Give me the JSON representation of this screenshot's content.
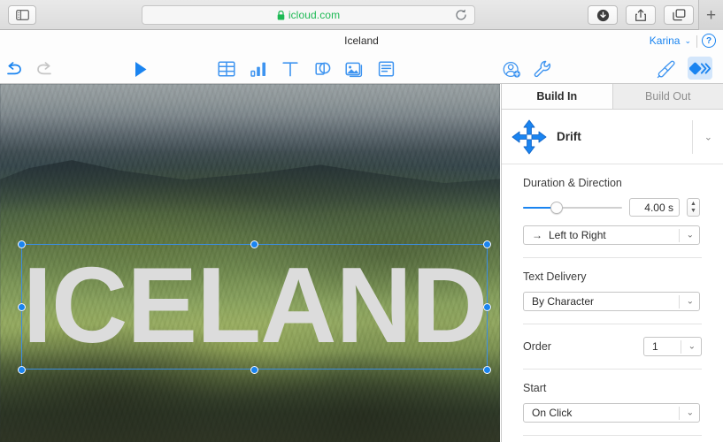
{
  "browser": {
    "sidebar_icon": "sidebar-toggle-icon",
    "url": "icloud.com",
    "lock_icon": "lock-icon",
    "reload_icon": "reload-icon",
    "downloads_icon": "downloads-icon",
    "share_icon": "share-icon",
    "tab_overview_icon": "tab-overview-icon",
    "new_tab_label": "+",
    "accent_green": "#1db954"
  },
  "document": {
    "title": "Iceland",
    "account_name": "Karina",
    "account_chevron": "⌄",
    "help_label": "?"
  },
  "toolbar": {
    "undo_icon": "undo-icon",
    "redo_icon": "redo-icon",
    "play_icon": "play-icon",
    "table_icon": "table-icon",
    "chart_icon": "chart-icon",
    "text_icon": "text-icon",
    "shape_icon": "shape-icon",
    "media_icon": "media-icon",
    "comment_icon": "comment-icon",
    "collaborate_icon": "add-collaborator-icon",
    "tools_icon": "tools-icon",
    "format_icon": "format-paintbrush-icon",
    "animate_icon": "animate-icon",
    "accent_blue": "#1a84f0"
  },
  "slide": {
    "text_object": "ICELAND",
    "text_color": "#dcdcdc",
    "selection_color": "#1a84f0"
  },
  "inspector": {
    "tabs": [
      {
        "label": "Build In",
        "active": true
      },
      {
        "label": "Build Out",
        "active": false
      }
    ],
    "effect": {
      "name": "Drift",
      "icon": "four-way-arrows-icon",
      "chevron": "⌄"
    },
    "duration": {
      "label": "Duration & Direction",
      "value": "4.00 s",
      "slider_percent": 32,
      "direction": "Left to Right",
      "direction_arrow": "→"
    },
    "text_delivery": {
      "label": "Text Delivery",
      "value": "By Character"
    },
    "order": {
      "label": "Order",
      "value": "1"
    },
    "start": {
      "label": "Start",
      "value": "On Click"
    }
  }
}
